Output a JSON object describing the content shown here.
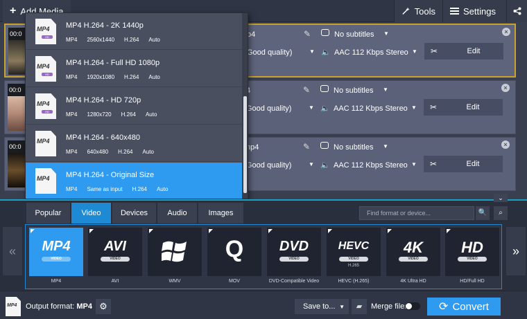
{
  "toolbar": {
    "add_media": "Add Media",
    "tools": "Tools",
    "settings": "Settings"
  },
  "files": [
    {
      "duration": "00:0",
      "name": "p4",
      "quality": "Good quality)",
      "subtitles": "No subtitles",
      "audio": "AAC 112 Kbps Stereo",
      "edit": "Edit",
      "selected": true
    },
    {
      "duration": "00:0",
      "name": "4",
      "quality": "Good quality)",
      "subtitles": "No subtitles",
      "audio": "AAC 112 Kbps Stereo",
      "edit": "Edit",
      "selected": false
    },
    {
      "duration": "00:0",
      "name": "np4",
      "quality": "Good quality)",
      "subtitles": "No subtitles",
      "audio": "AAC 112 Kbps Stereo",
      "edit": "Edit",
      "selected": false
    }
  ],
  "presets": [
    {
      "icon_text": "MP4",
      "badge": "HD",
      "title": "MP4 H.264 - 2K 1440p",
      "meta": [
        "MP4",
        "2560x1440",
        "H.264",
        "Auto"
      ]
    },
    {
      "icon_text": "MP4",
      "badge": "HD",
      "title": "MP4 H.264 - Full HD 1080p",
      "meta": [
        "MP4",
        "1920x1080",
        "H.264",
        "Auto"
      ]
    },
    {
      "icon_text": "MP4",
      "badge": "HD",
      "title": "MP4 H.264 - HD 720p",
      "meta": [
        "MP4",
        "1280x720",
        "H.264",
        "Auto"
      ]
    },
    {
      "icon_text": "MP4",
      "badge": "",
      "title": "MP4 H.264 - 640x480",
      "meta": [
        "MP4",
        "640x480",
        "H.264",
        "Auto"
      ]
    },
    {
      "icon_text": "MP4",
      "badge": "",
      "title": "MP4 H.264 - Original Size",
      "meta": [
        "MP4",
        "Same as input",
        "H.264",
        "Auto"
      ]
    }
  ],
  "tabs": [
    "Popular",
    "Video",
    "Devices",
    "Audio",
    "Images"
  ],
  "active_tab": "Video",
  "search": {
    "placeholder": "Find format or device..."
  },
  "formats": [
    {
      "big": "MP4",
      "pill": "VIDEO",
      "sub": "",
      "label": "MP4"
    },
    {
      "big": "AVI",
      "pill": "VIDEO",
      "sub": "",
      "label": "AVI"
    },
    {
      "big": "",
      "pill": "",
      "sub": "",
      "label": "WMV"
    },
    {
      "big": "Q",
      "pill": "",
      "sub": "",
      "label": "MOV"
    },
    {
      "big": "DVD",
      "pill": "VIDEO",
      "sub": "",
      "label": "DVD-Compatible Video"
    },
    {
      "big": "HEVC",
      "pill": "VIDEO",
      "sub": "H.265",
      "label": "HEVC (H.265)"
    },
    {
      "big": "4K",
      "pill": "VIDEO",
      "sub": "",
      "label": "4K Ultra HD"
    },
    {
      "big": "HD",
      "pill": "VIDEO",
      "sub": "",
      "label": "HD/Full HD"
    }
  ],
  "bottom": {
    "output_label": "Output format:",
    "output_value": "MP4",
    "output_icon": "MP4",
    "save_to": "Save to...",
    "merge": "Merge files",
    "convert": "Convert"
  },
  "colors": {
    "accent": "#2e9bf0",
    "selected_border": "#c9a230"
  }
}
